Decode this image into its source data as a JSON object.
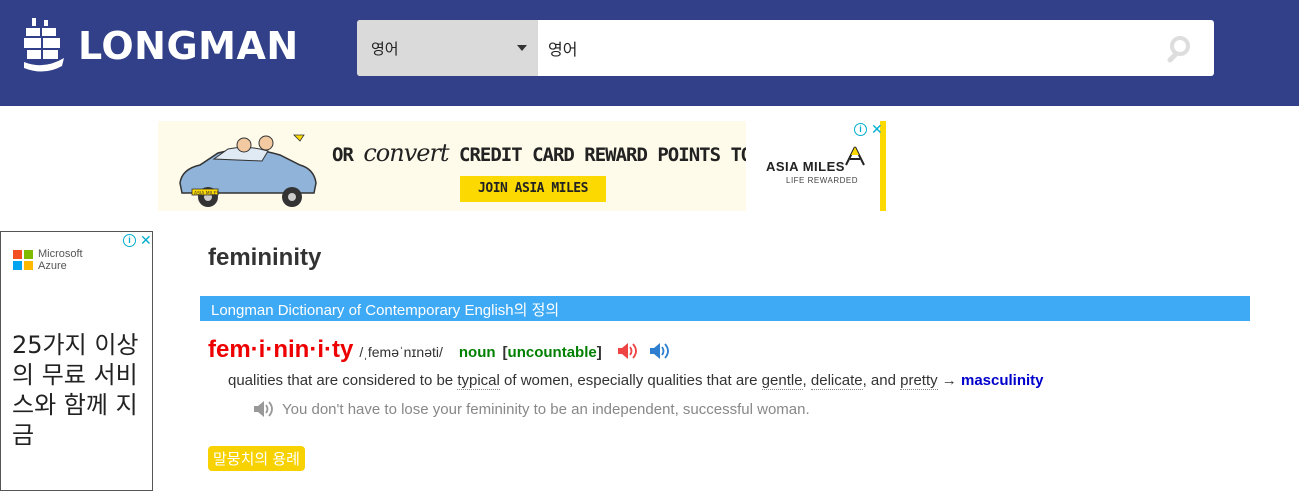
{
  "header": {
    "logo_text": "LONGMAN",
    "search": {
      "dictionary_selected": "영어",
      "query": "영어"
    }
  },
  "ad_top": {
    "headline_prefix": "OR",
    "headline_script": "convert",
    "headline_suffix": "CREDIT CARD REWARD POINTS TO MILES",
    "cta": "JOIN ASIA MILES",
    "brand": "ASIA MILES",
    "tagline": "LIFE REWARDED",
    "car_plate": "ASIA MILES",
    "accent_color": "#fcd900"
  },
  "ad_side": {
    "brand_line1": "Microsoft",
    "brand_line2": "Azure",
    "copy": "25가지 이상의 무료 서비스와 함께 지금"
  },
  "entry": {
    "title": "femininity",
    "dictionary_bar": "Longman Dictionary of Contemporary English의 정의",
    "headword": "fem·i·nin·i·ty",
    "pronunciation": "/ˌfeməˈnɪnəti/",
    "part_of_speech": "noun",
    "grammar_open": "[",
    "grammar": "uncountable",
    "grammar_close": "]",
    "definition": {
      "t1": "qualities that are considered to be ",
      "w1": "typical",
      "t2": " of women, especially qualities that are ",
      "w2": "gentle",
      "t3": ", ",
      "w3": "delicate",
      "t4": ", and ",
      "w4": "pretty",
      "arrow": " → ",
      "xref": "masculinity"
    },
    "example": "You don't have to lose your femininity to be an independent, successful woman.",
    "collocations_label": "말뭉치의 용례"
  },
  "colors": {
    "header_bg": "#314089",
    "dict_bar": "#3ea9f5",
    "headword": "#e00000",
    "pos": "#008000",
    "xref": "#0000cc",
    "colloc_bg": "#f8d100"
  }
}
